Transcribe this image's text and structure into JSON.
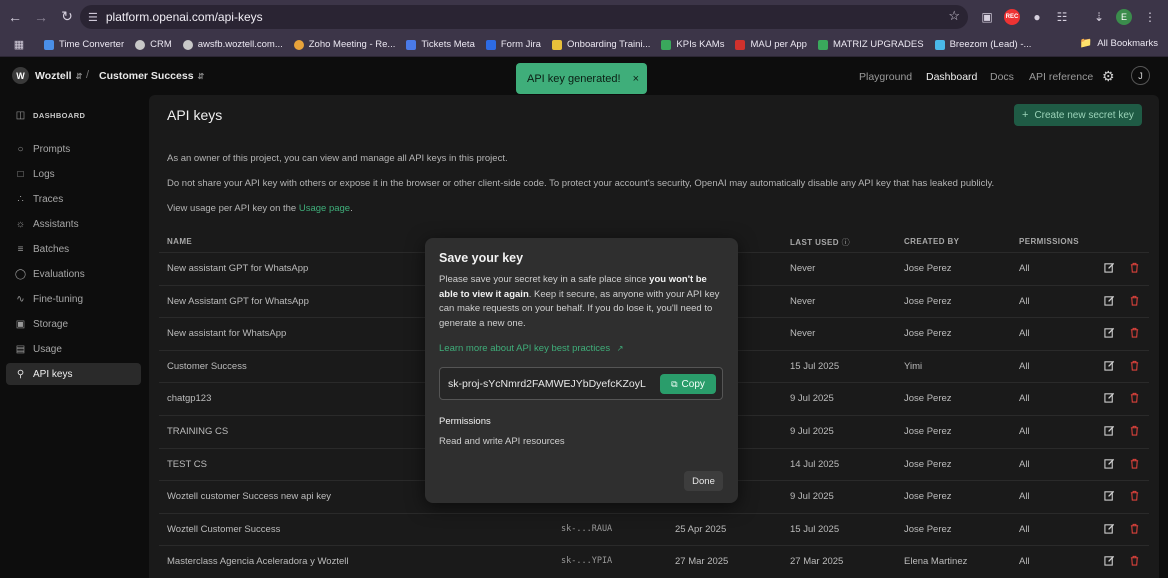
{
  "browser": {
    "url": "platform.openai.com/api-keys",
    "bookmarks": [
      {
        "label": "Time Converter",
        "color": "#4a8fe8"
      },
      {
        "label": "CRM",
        "color": "#c8c8c8"
      },
      {
        "label": "awsfb.woztell.com...",
        "color": "#c8c8c8"
      },
      {
        "label": "Zoho Meeting - Re...",
        "color": "#e8a33a"
      },
      {
        "label": "Tickets Meta",
        "color": "#4a7ae8"
      },
      {
        "label": "Form Jira",
        "color": "#2d6be4"
      },
      {
        "label": "Onboarding Traini...",
        "color": "#e8c03a"
      },
      {
        "label": "KPIs KAMs",
        "color": "#3aa85c"
      },
      {
        "label": "MAU per App",
        "color": "#d0312d"
      },
      {
        "label": "MATRIZ UPGRADES",
        "color": "#3aa85c"
      },
      {
        "label": "Breezom (Lead) -...",
        "color": "#4ab8e8"
      }
    ],
    "all_bookmarks": "All Bookmarks",
    "profile_initial": "E",
    "rec_label": "REC"
  },
  "header": {
    "org_initial": "W",
    "org_name": "Woztell",
    "separator": "/",
    "project_name": "Customer Success",
    "nav": {
      "playground": "Playground",
      "dashboard": "Dashboard",
      "docs": "Docs",
      "api_reference": "API reference"
    },
    "user_initial": "J"
  },
  "toast": {
    "message": "API key generated!",
    "close": "×"
  },
  "sidebar": {
    "heading": "DASHBOARD",
    "items": [
      {
        "label": "Prompts",
        "icon": "prompt-icon"
      },
      {
        "label": "Logs",
        "icon": "logs-icon"
      },
      {
        "label": "Traces",
        "icon": "traces-icon"
      },
      {
        "label": "Assistants",
        "icon": "assistants-icon"
      },
      {
        "label": "Batches",
        "icon": "batches-icon"
      },
      {
        "label": "Evaluations",
        "icon": "evaluations-icon"
      },
      {
        "label": "Fine-tuning",
        "icon": "fine-tuning-icon"
      },
      {
        "label": "Storage",
        "icon": "storage-icon"
      },
      {
        "label": "Usage",
        "icon": "usage-icon"
      },
      {
        "label": "API keys",
        "icon": "key-icon"
      }
    ]
  },
  "main": {
    "title": "API keys",
    "create_button": "Create new secret key",
    "para1": "As an owner of this project, you can view and manage all API keys in this project.",
    "para2": "Do not share your API key with others or expose it in the browser or other client-side code. To protect your account's security, OpenAI may automatically disable any API key that has leaked publicly.",
    "para3_prefix": "View usage per API key on the ",
    "para3_link": "Usage page",
    "para3_suffix": ".",
    "columns": {
      "name": "NAME",
      "last_used": "LAST USED",
      "created_by": "CREATED BY",
      "permissions": "PERMISSIONS"
    },
    "rows": [
      {
        "name": "New assistant GPT for WhatsApp",
        "key": "",
        "created": "",
        "last_used": "Never",
        "created_by": "Jose Perez",
        "permissions": "All"
      },
      {
        "name": "New Assistant GPT for WhatsApp",
        "key": "",
        "created": "",
        "last_used": "Never",
        "created_by": "Jose Perez",
        "permissions": "All"
      },
      {
        "name": "New assistant for WhatsApp",
        "key": "",
        "created": "",
        "last_used": "Never",
        "created_by": "Jose Perez",
        "permissions": "All"
      },
      {
        "name": "Customer Success",
        "key": "",
        "created": "",
        "last_used": "15 Jul 2025",
        "created_by": "Yimi",
        "permissions": "All"
      },
      {
        "name": "chatgp123",
        "key": "",
        "created": "",
        "last_used": "9 Jul 2025",
        "created_by": "Jose Perez",
        "permissions": "All"
      },
      {
        "name": "TRAINING CS",
        "key": "",
        "created": "",
        "last_used": "9 Jul 2025",
        "created_by": "Jose Perez",
        "permissions": "All"
      },
      {
        "name": "TEST CS",
        "key": "",
        "created": "",
        "last_used": "14 Jul 2025",
        "created_by": "Jose Perez",
        "permissions": "All"
      },
      {
        "name": "Woztell customer Success new api key",
        "key": "",
        "created": "",
        "last_used": "9 Jul 2025",
        "created_by": "Jose Perez",
        "permissions": "All"
      },
      {
        "name": "Woztell Customer Success",
        "key": "sk-...RAUA",
        "created": "25 Apr 2025",
        "last_used": "15 Jul 2025",
        "created_by": "Jose Perez",
        "permissions": "All"
      },
      {
        "name": "Masterclass Agencia Aceleradora y Woztell",
        "key": "sk-...YPIA",
        "created": "27 Mar 2025",
        "last_used": "27 Mar 2025",
        "created_by": "Elena Martinez",
        "permissions": "All"
      }
    ]
  },
  "modal": {
    "title": "Save your key",
    "body_prefix": "Please save your secret key in a safe place since ",
    "body_bold": "you won't be able to view it again",
    "body_suffix": ". Keep it secure, as anyone with your API key can make requests on your behalf. If you do lose it, you'll need to generate a new one.",
    "learn_more": "Learn more about API key best practices",
    "key_value": "sk-proj-sYcNmrd2FAMWEJYbDyefcKZoyL",
    "copy_label": "Copy",
    "permissions_heading": "Permissions",
    "permissions_value": "Read and write API resources",
    "done_label": "Done"
  },
  "colors": {
    "accent": "#3fae7a",
    "danger": "#e0141b"
  }
}
